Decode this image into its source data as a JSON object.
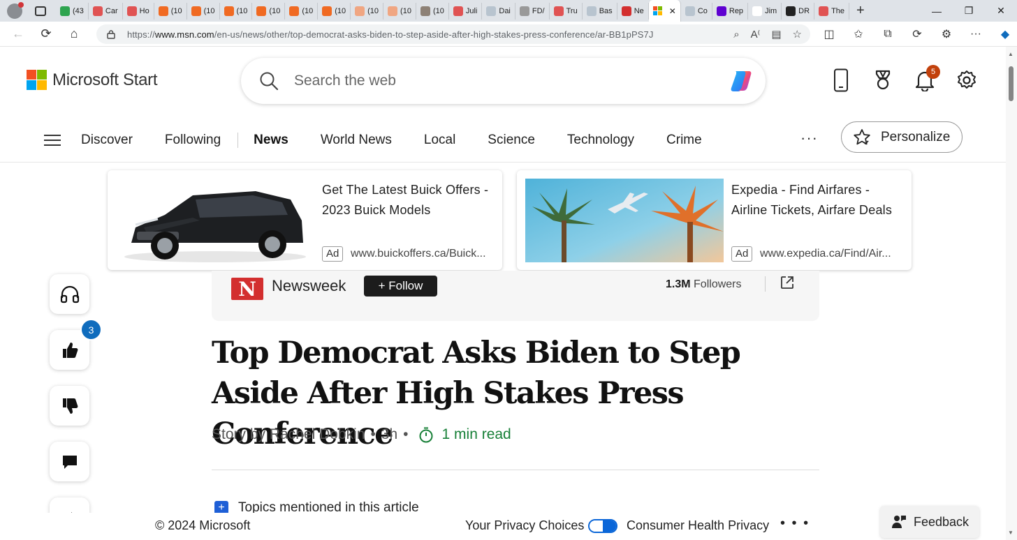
{
  "browser": {
    "tabs": [
      {
        "label": "(43",
        "color": "#2ea44f"
      },
      {
        "label": "Car",
        "color": "#e05353"
      },
      {
        "label": "Ho",
        "color": "#e05353"
      },
      {
        "label": "(10",
        "color": "#f06a22"
      },
      {
        "label": "(10",
        "color": "#f06a22"
      },
      {
        "label": "(10",
        "color": "#f06a22"
      },
      {
        "label": "(10",
        "color": "#f06a22"
      },
      {
        "label": "(10",
        "color": "#f06a22"
      },
      {
        "label": "(10",
        "color": "#f06a22"
      },
      {
        "label": "(10",
        "color": "#f0a682"
      },
      {
        "label": "(10",
        "color": "#f0a682"
      },
      {
        "label": "(10",
        "color": "#8d8176"
      },
      {
        "label": "Juli",
        "color": "#e05353"
      },
      {
        "label": "Dai",
        "color": "#b8c4cf"
      },
      {
        "label": "FD/",
        "color": "#999999"
      },
      {
        "label": "Tru",
        "color": "#e05353"
      },
      {
        "label": "Bas",
        "color": "#b8c4cf"
      },
      {
        "label": "Ne",
        "color": "#d32f2f"
      }
    ],
    "active_tab_close": "✕",
    "tabs_after": [
      {
        "label": "Co",
        "color": "#b8c4cf"
      },
      {
        "label": "Rep",
        "color": "#5f01d1"
      },
      {
        "label": "Jim",
        "color": "#ffffff"
      },
      {
        "label": "DR",
        "color": "#222222"
      },
      {
        "label": "The",
        "color": "#e05353"
      }
    ],
    "new_tab": "+",
    "url_prefix": "https://",
    "url_host": "www.msn.com",
    "url_path": "/en-us/news/other/top-democrat-asks-biden-to-step-aside-after-high-stakes-press-conference/ar-BB1pPS7J"
  },
  "header": {
    "brand": "Microsoft Start",
    "search_placeholder": "Search the web",
    "notification_count": "5"
  },
  "nav": {
    "items": [
      "Discover",
      "Following",
      "News",
      "World News",
      "Local",
      "Science",
      "Technology",
      "Crime"
    ],
    "selected": "News",
    "more": "···",
    "personalize": "Personalize"
  },
  "ads": [
    {
      "title": "Get The Latest Buick Offers - 2023 Buick Models",
      "tag": "Ad",
      "url": "www.buickoffers.ca/Buick..."
    },
    {
      "title": "Expedia - Find Airfares - Airline Tickets, Airfare Deals",
      "tag": "Ad",
      "url": "www.expedia.ca/Find/Air..."
    }
  ],
  "publisher": {
    "logo_letter": "N",
    "name": "Newsweek",
    "follow": "+ Follow",
    "followers_count": "1.3M",
    "followers_label": "Followers"
  },
  "rail": {
    "like_count": "3"
  },
  "article": {
    "headline": "Top Democrat Asks Biden to Step Aside After High Stakes Press Conference",
    "byline": "Story by Rachel Dobkin",
    "age": "3h",
    "read_time": "1 min read",
    "topics_label": "Topics mentioned in this article"
  },
  "footer": {
    "copyright": "© 2024 Microsoft",
    "privacy": "Your Privacy Choices",
    "health": "Consumer Health Privacy",
    "more": "• • •",
    "feedback": "Feedback"
  },
  "colors": {
    "accent": "#0f6cbd",
    "read_time": "#188038",
    "badge": "#c2410c"
  }
}
